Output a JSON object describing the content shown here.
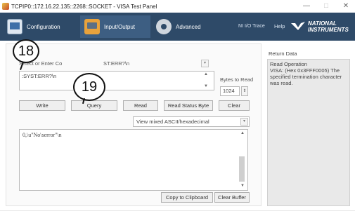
{
  "window": {
    "title": "TCPIP0::172.16.22.135::2268::SOCKET - VISA Test Panel",
    "minimize": "—",
    "maximize": "□",
    "close": "✕"
  },
  "toolbar": {
    "configuration": "Configuration",
    "input_output": "Input/Output",
    "advanced": "Advanced",
    "ni_io_trace": "NI I/O Trace",
    "help": "Help",
    "logo_line1": "NATIONAL",
    "logo_line2": "INSTRUMENTS"
  },
  "io": {
    "command_label": "Select or Enter Co",
    "command_overlay": "ST:ERR?\\n",
    "command_value": ":SYST:ERR?\\n",
    "bytes_to_read_label": "Bytes to Read",
    "bytes_to_read_value": "1024",
    "write_btn": "Write",
    "query_btn": "Query",
    "read_btn": "Read",
    "read_status_btn": "Read Status Byte",
    "clear_btn": "Clear",
    "view_mode": "View mixed ASCII/hexadecimal",
    "output_text": "0,\\u\"No\\serror\"\\n",
    "copy_btn": "Copy to Clipboard",
    "clear_buffer_btn": "Clear Buffer"
  },
  "return_data": {
    "label": "Return Data",
    "line1": "Read Operation",
    "line2": "VISA:  (Hex 0x3FFF0005) The specified termination character was read."
  },
  "callouts": {
    "a": "18",
    "b": "19"
  },
  "colors": {
    "toolbar": "#2e4a68",
    "accent_orange": "#e8a23c"
  }
}
